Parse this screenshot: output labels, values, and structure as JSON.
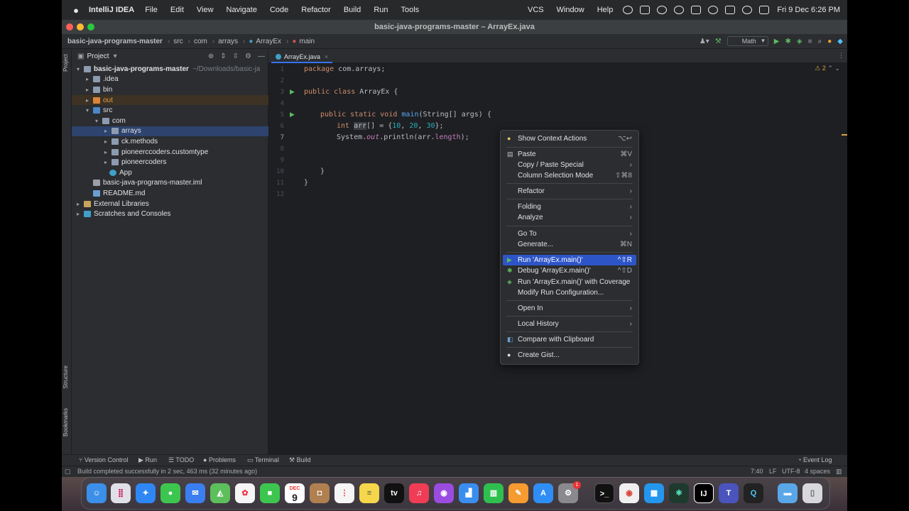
{
  "menubar": {
    "app_name": "IntelliJ IDEA",
    "menus": [
      "File",
      "Edit",
      "View",
      "Navigate",
      "Code",
      "Refactor",
      "Build",
      "Run",
      "Tools"
    ],
    "right_menus": [
      "VCS",
      "Window",
      "Help"
    ],
    "clock": "Fri 9 Dec  6:26 PM"
  },
  "window": {
    "title": "basic-java-programs-master – ArrayEx.java"
  },
  "navbar": {
    "crumbs": [
      "basic-java-programs-master",
      "src",
      "com",
      "arrays",
      "ArrayEx",
      "main"
    ],
    "run_config": "Math"
  },
  "side_labels": {
    "project": "Project",
    "structure": "Structure",
    "bookmarks": "Bookmarks"
  },
  "project_panel": {
    "title": "Project",
    "root_name": "basic-java-programs-master",
    "root_path": "~/Downloads/basic-ja",
    "items": [
      ".idea",
      "bin",
      "out",
      "src",
      "com",
      "arrays",
      "ck.methods",
      "pioneerccoders.customtype",
      "pioneercoders",
      "App",
      "basic-java-programs-master.iml",
      "README.md",
      "External Libraries",
      "Scratches and Consoles"
    ]
  },
  "editor": {
    "tab": "ArrayEx.java",
    "warnings": "2",
    "line_numbers": [
      "1",
      "2",
      "3",
      "4",
      "5",
      "6",
      "7",
      "8",
      "9",
      "10",
      "11",
      "12"
    ],
    "code": {
      "l1_kw": "package",
      "l1_rest": " com.arrays;",
      "l3_kw": "public class",
      "l3_rest": " ArrayEx {",
      "l5_kw": "public static void",
      "l5_m": "main",
      "l5_rest": "(String[] args) {",
      "l6_kw": "int",
      "l6_var": "arr",
      "l6_a": "[] = {",
      "l6_n1": "10",
      "l6_c1": ", ",
      "l6_n2": "20",
      "l6_c2": ", ",
      "l6_n3": "30",
      "l6_end": "};",
      "l7_a": "System.",
      "l7_out": "out",
      "l7_b": ".println(arr.",
      "l7_len": "length",
      "l7_c": ");",
      "l10": "}",
      "l11": "}"
    }
  },
  "context_menu": {
    "show_context_actions": "Show Context Actions",
    "show_context_actions_sc": "⌥↩",
    "paste": "Paste",
    "paste_sc": "⌘V",
    "copy_paste_special": "Copy / Paste Special",
    "column_selection": "Column Selection Mode",
    "column_selection_sc": "⇧⌘8",
    "refactor": "Refactor",
    "folding": "Folding",
    "analyze": "Analyze",
    "go_to": "Go To",
    "generate": "Generate...",
    "generate_sc": "⌘N",
    "run": "Run 'ArrayEx.main()'",
    "run_sc": "^⇧R",
    "debug": "Debug 'ArrayEx.main()'",
    "debug_sc": "^⇧D",
    "run_coverage": "Run 'ArrayEx.main()' with Coverage",
    "modify_run": "Modify Run Configuration...",
    "open_in": "Open In",
    "local_history": "Local History",
    "compare_clipboard": "Compare with Clipboard",
    "create_gist": "Create Gist..."
  },
  "bottom_tools": [
    "Version Control",
    "Run",
    "TODO",
    "Problems",
    "Terminal",
    "Build"
  ],
  "event_log": "Event Log",
  "status": {
    "message": "Build completed successfully in 2 sec, 463 ms (32 minutes ago)",
    "position": "7:40",
    "line_sep": "LF",
    "encoding": "UTF-8",
    "indent": "4 spaces"
  },
  "dock": {
    "calendar_month": "DEC",
    "calendar_day": "9",
    "tv_label": "tv",
    "badge": "1"
  }
}
